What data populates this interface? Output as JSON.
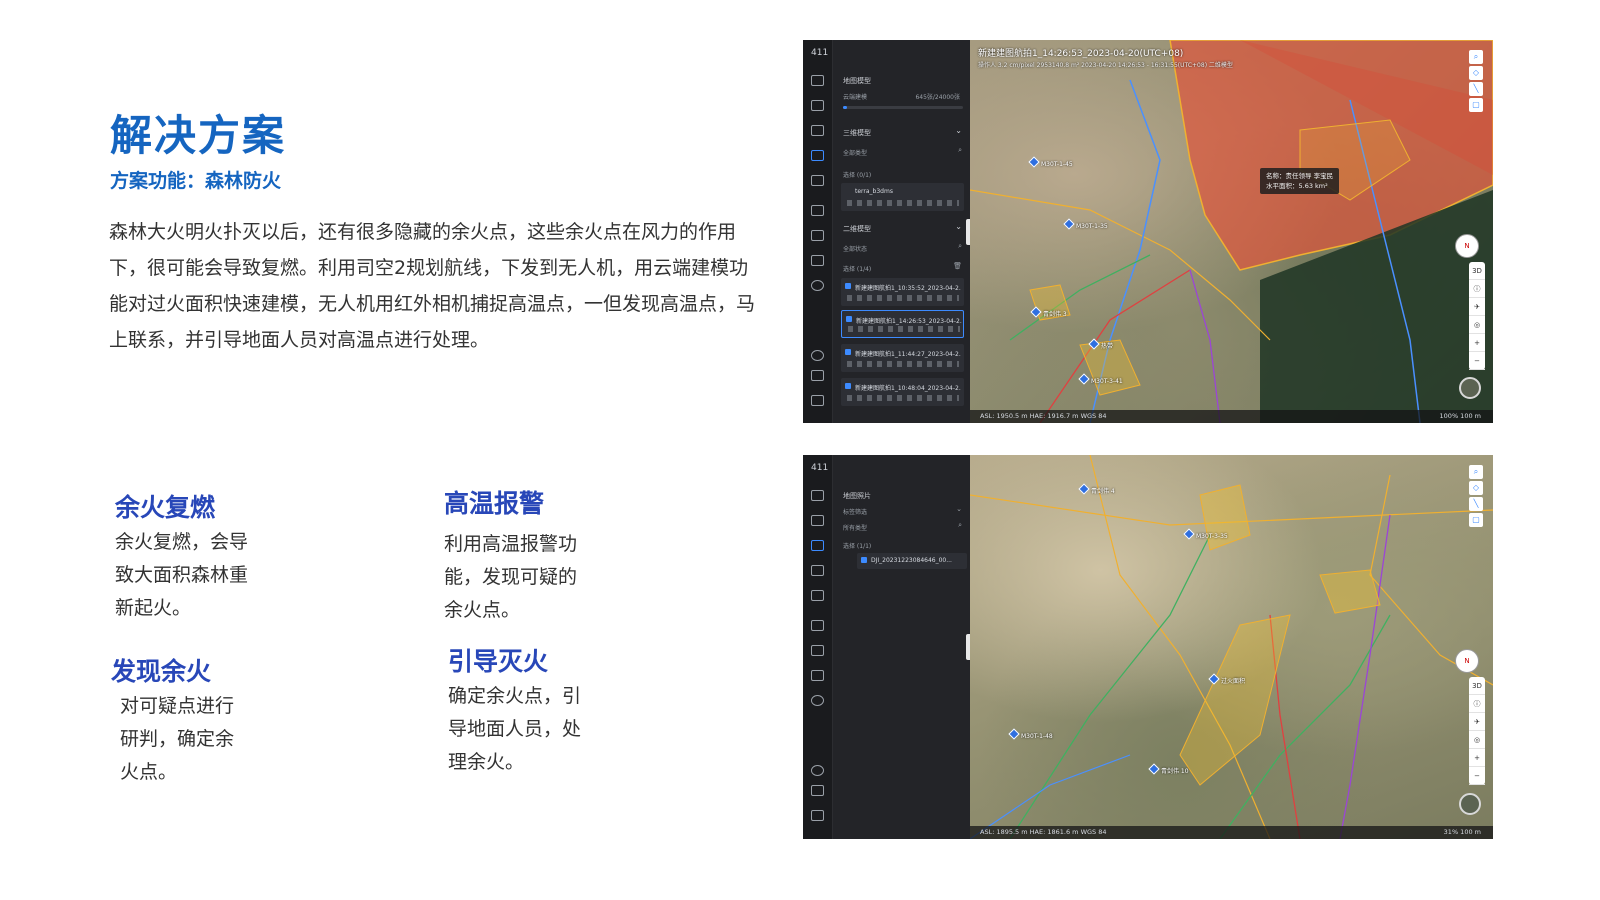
{
  "slide": {
    "title": "解决方案",
    "subtitle": "方案功能：森林防火",
    "intro": "森林大火明火扑灭以后，还有很多隐藏的余火点，这些余火点在风力的作用下，很可能会导致复燃。利用司空2规划航线，下发到无人机，用云端建模功能对过火面积快速建模，无人机用红外相机捕捉高温点，一但发现高温点，马上联系，并引导地面人员对高温点进行处理。",
    "features": [
      {
        "title": "余火复燃",
        "line1": "余火复燃，会导",
        "line2": "致大面积森林重",
        "line3": "新起火。"
      },
      {
        "title": "高温报警",
        "line1": "利用高温报警功",
        "line2": "能，发现可疑的",
        "line3": "余火点。"
      },
      {
        "title": "发现余火",
        "line1": "对可疑点进行",
        "line2": "研判，确定余",
        "line3": "火点。"
      },
      {
        "title": "引导灭火",
        "line1": "确定余火点，引",
        "line2": "导地面人员，处",
        "line3": "理余火。"
      }
    ]
  },
  "screen_top": {
    "app_id": "411",
    "section_map_model": "地图模型",
    "cloud_model_label": "云端建模",
    "cloud_model_count": "645张/24000张",
    "cloud_model_progress": 0.03,
    "section_3d": "三维模型",
    "filter_all_types": "全部类型",
    "select_3d": "选择 (0/1)",
    "model_3d_item": "terra_b3dms",
    "section_2d": "二维模型",
    "filter_all_status": "全部状态",
    "select_2d": "选择 (1/4)",
    "models_2d": [
      "新建建图航拍1_10:35:52_2023-04-2...",
      "新建建图航拍1_14:26:53_2023-04-2...",
      "新建建图航拍1_11:44:27_2023-04-2...",
      "新建建图航拍1_10:48:04_2023-04-2..."
    ],
    "map_title": "新建建图航拍1_14:26:53_2023-04-20(UTC+08)",
    "map_meta": "操作人   3.2 cm/pixel   2953140.8 m²   2023-04-20 14:26:53 - 16:31:55(UTC+08)   二维模型",
    "callout_name": "名称：责任领导 李宝民",
    "callout_area": "水平面积：5.63 km²",
    "status_left": "ASL: 1950.5 m    HAE: 1916.7 m    WGS 84",
    "status_right": "100%    100 m"
  },
  "screen_bottom": {
    "app_id": "411",
    "section_map_photo": "地图照片",
    "filter_tag": "标签筛选",
    "filter_all_types": "所有类型",
    "select_photo": "选择 (1/1)",
    "photo_item": "DJI_20231223084646_00...",
    "status_left": "ASL: 1895.5 m    HAE: 1861.6 m    WGS 84",
    "status_right": "31%    100 m"
  },
  "map_labels": {
    "p1": "M30T-1-45",
    "p2": "M30T-1-35",
    "p3": "青剑伟 3",
    "p4": "热带",
    "p5": "M30T-3-41",
    "p6": "过火面积",
    "p7": "青剑伟 4",
    "p8": "M30T-3-35",
    "p9": "M30T-1-48",
    "p10": "青剑伟 10"
  },
  "nav": {
    "compass": "N",
    "view3d": "3D",
    "zoom_in": "+",
    "zoom_out": "−"
  },
  "colors": {
    "brand_blue": "#1565c0",
    "feature_blue": "#2847b8",
    "accent": "#3d8bff",
    "burn_area": "#e0553c"
  }
}
